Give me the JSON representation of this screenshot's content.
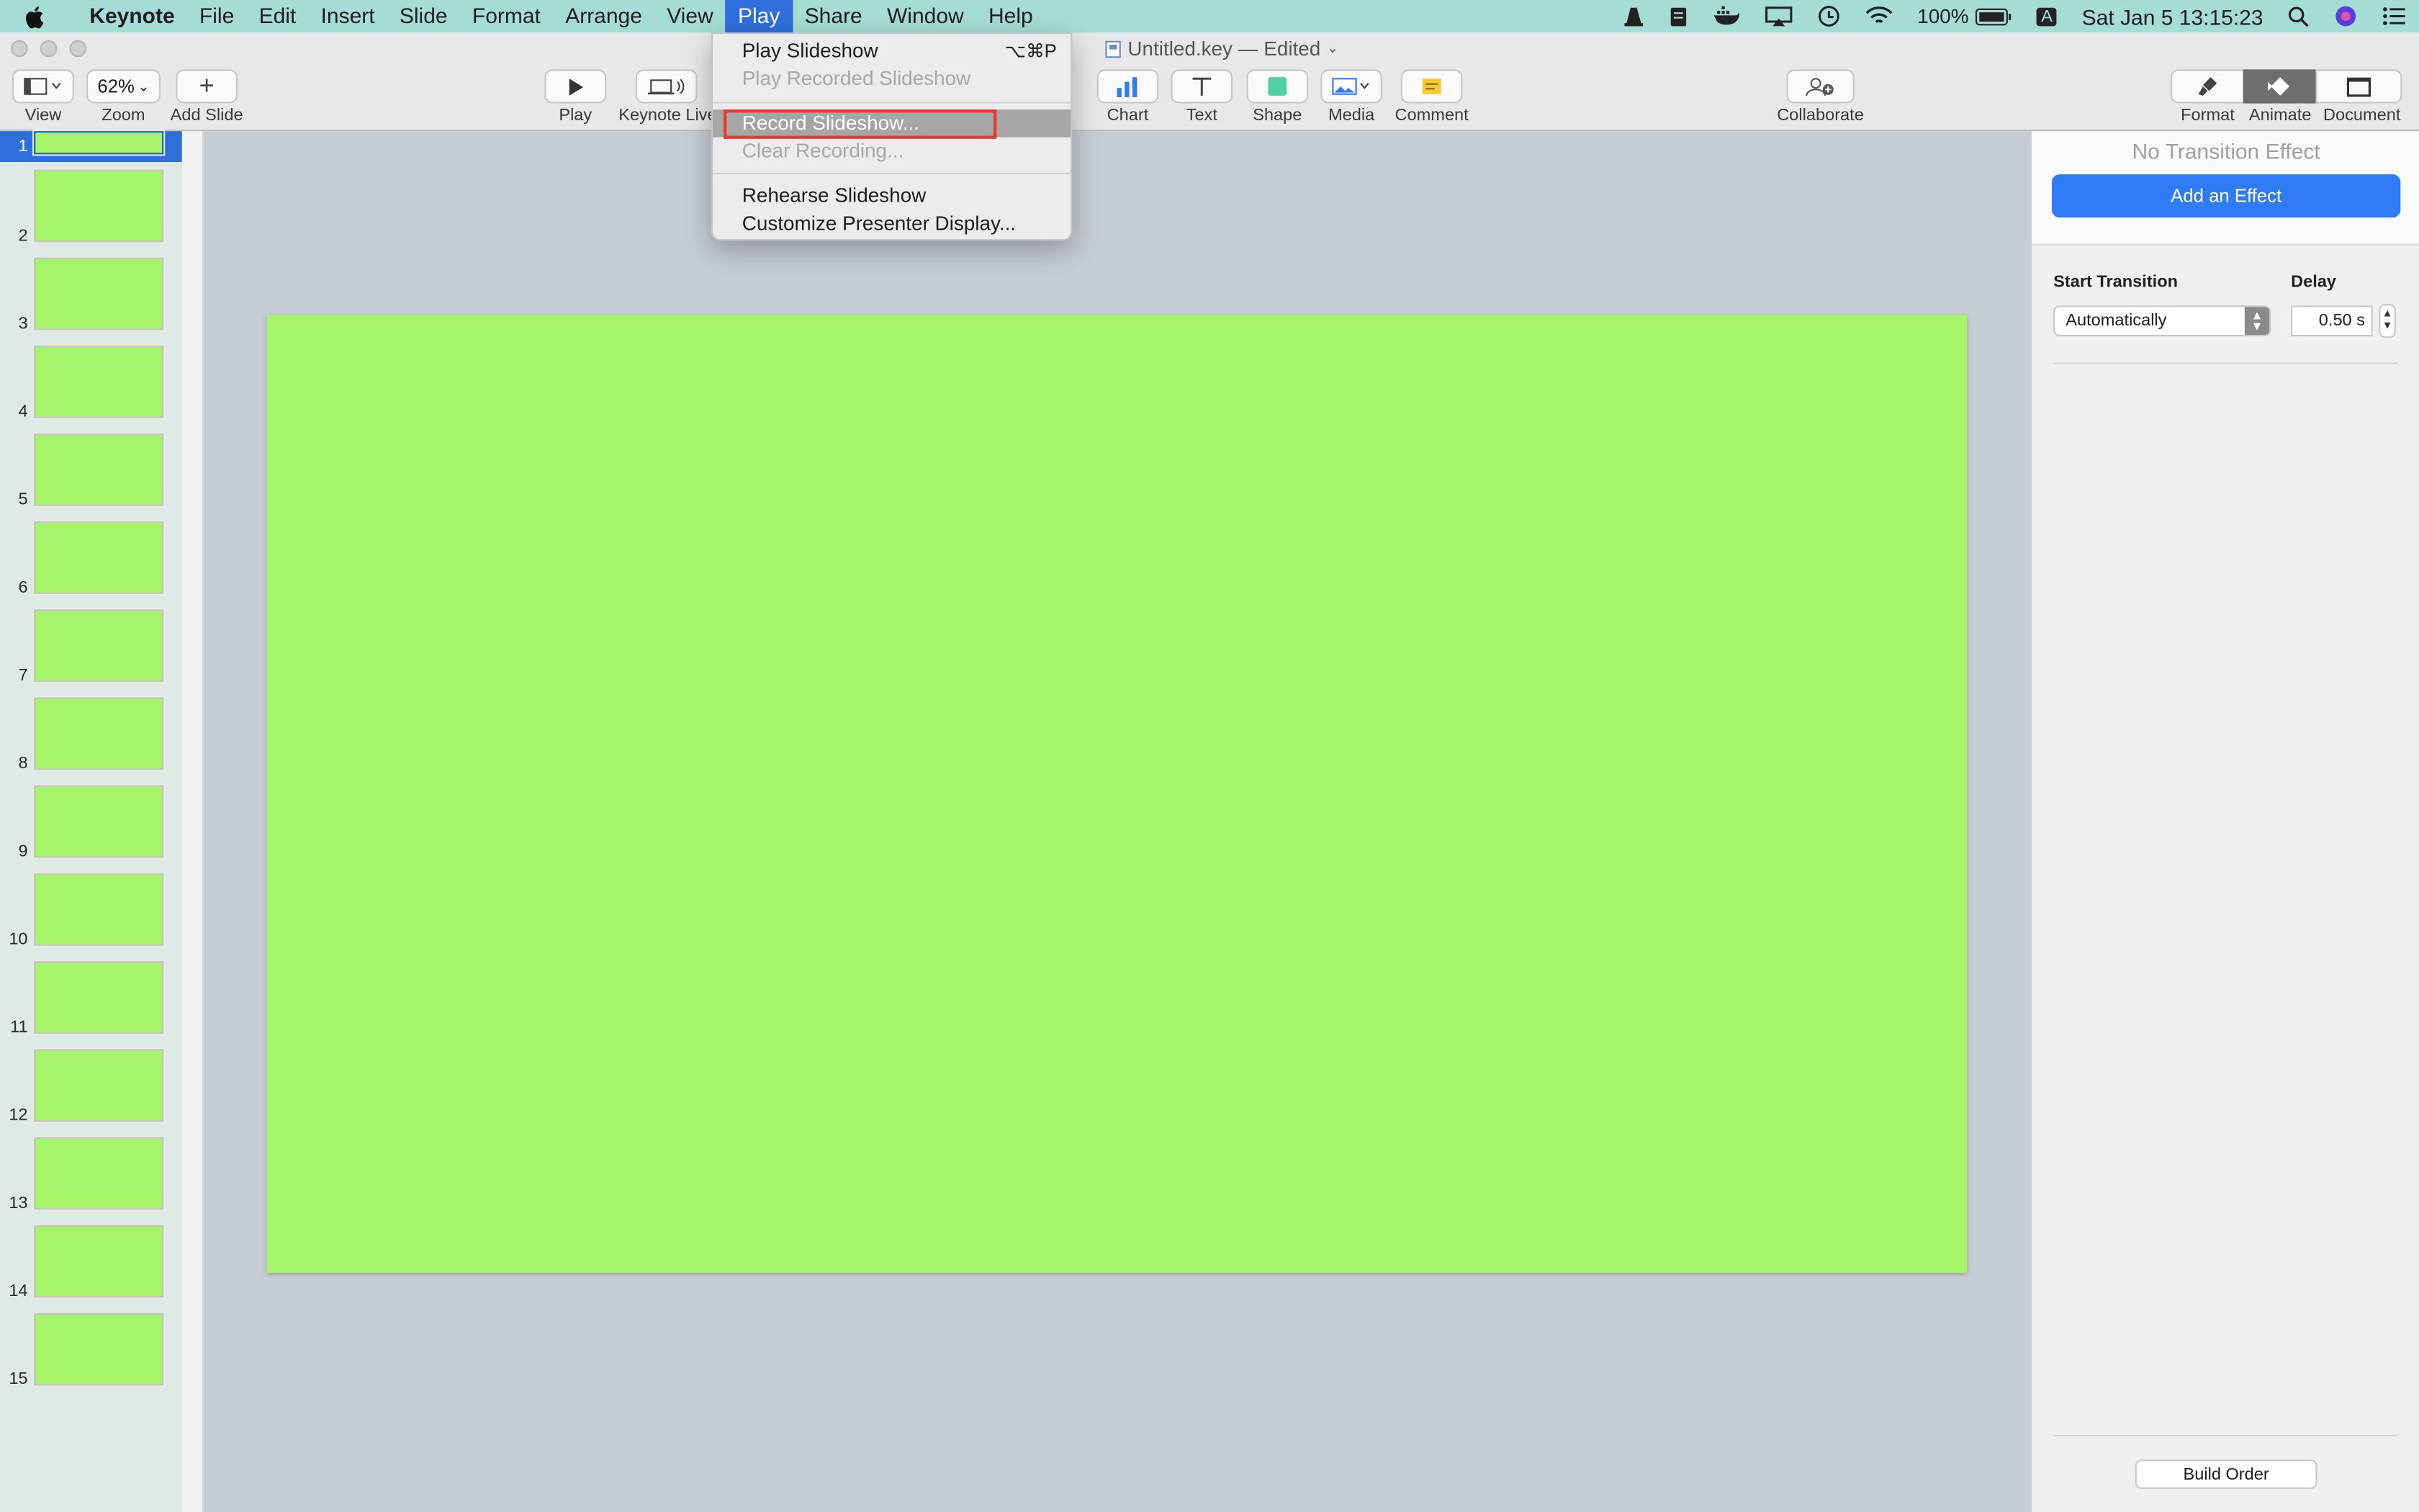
{
  "menubar": {
    "app_name": "Keynote",
    "menus": [
      "File",
      "Edit",
      "Insert",
      "Slide",
      "Format",
      "Arrange",
      "View",
      "Play",
      "Share",
      "Window",
      "Help"
    ],
    "battery": "100%",
    "input_source": "A",
    "clock": "Sat Jan 5  13:15:23"
  },
  "document": {
    "title": "Untitled.key — Edited"
  },
  "toolbar": {
    "view_label": "View",
    "zoom_value": "62%",
    "zoom_label": "Zoom",
    "add_slide_label": "Add Slide",
    "play_label": "Play",
    "keynote_live_label": "Keynote Live",
    "chart_label": "Chart",
    "text_label": "Text",
    "shape_label": "Shape",
    "media_label": "Media",
    "comment_label": "Comment",
    "collaborate_label": "Collaborate",
    "format_label": "Format",
    "animate_label": "Animate",
    "document_label": "Document"
  },
  "play_menu": {
    "items": [
      {
        "label": "Play Slideshow",
        "shortcut": "⌥⌘P",
        "enabled": true
      },
      {
        "label": "Play Recorded Slideshow",
        "shortcut": "",
        "enabled": false
      },
      {
        "label": "Record Slideshow...",
        "shortcut": "",
        "enabled": true,
        "highlighted": true
      },
      {
        "label": "Clear Recording...",
        "shortcut": "",
        "enabled": false
      },
      {
        "label": "Rehearse Slideshow",
        "shortcut": "",
        "enabled": true
      },
      {
        "label": "Customize Presenter Display...",
        "shortcut": "",
        "enabled": true
      }
    ]
  },
  "slides": {
    "selected": "1",
    "numbers": [
      "1",
      "2",
      "3",
      "4",
      "5",
      "6",
      "7",
      "8",
      "9",
      "10",
      "11",
      "12",
      "13",
      "14",
      "15"
    ],
    "background_color": "#a6f46a"
  },
  "inspector": {
    "no_transition": "No Transition Effect",
    "add_effect": "Add an Effect",
    "start_transition_label": "Start Transition",
    "start_transition_value": "Automatically",
    "delay_label": "Delay",
    "delay_value": "0.50 s",
    "build_order": "Build Order"
  },
  "colors": {
    "menubar": "#a6dcd6",
    "accent": "#2f7cf6",
    "slide": "#a6f46a",
    "highlight_box": "#e63a2e"
  }
}
